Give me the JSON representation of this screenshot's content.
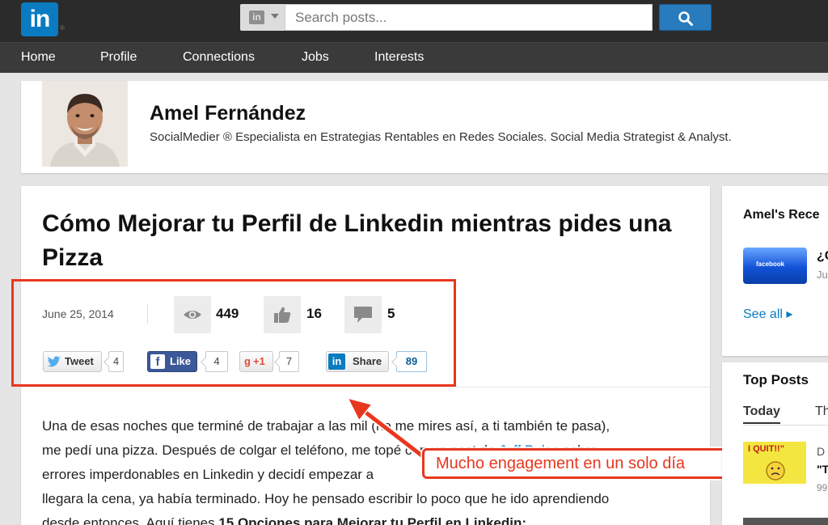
{
  "topbar": {
    "logo_text": "in",
    "logo_reg": "®",
    "search_scope_icon": "linkedin-mini-icon",
    "search_placeholder": "Search posts...",
    "search_button_icon": "search-icon"
  },
  "nav": {
    "items": [
      "Home",
      "Profile",
      "Connections",
      "Jobs",
      "Interests"
    ]
  },
  "profile": {
    "name": "Amel Fernández",
    "headline": "SocialMedier ® Especialista en Estrategias Rentables en Redes Sociales. Social Media Strategist & Analyst."
  },
  "article": {
    "title": "Cómo Mejorar tu Perfil de Linkedin mientras pides una Pizza",
    "date": "June 25, 2014",
    "stats": {
      "views": "449",
      "likes": "16",
      "comments": "5"
    },
    "share": {
      "tweet_label": "Tweet",
      "tweet_count": "4",
      "like_label": "Like",
      "like_count": "4",
      "gplus_label": "+1",
      "gplus_count": "7",
      "linkedin_label": "Share",
      "linkedin_count": "89"
    },
    "body": {
      "line1": "Una de esas noches que terminé de trabajar a las mil (no me mires así, a ti también te pasa),",
      "line2_a": "me pedí una pizza. Después de colgar el teléfono, me topé con un post de ",
      "line2_link": "Jeff Bulas",
      "line2_b": " sobre",
      "line3": "errores imperdonables en Linkedin y decidí empezar a",
      "line4": "llegara la cena, ya había terminado. Hoy he pensado escribir lo poco que he ido aprendiendo",
      "line5_a": "desde entonces. Aquí tienes ",
      "line5_bold": "15 Opciones para Mejorar tu Perfil en Linkedin:"
    }
  },
  "annotation": {
    "callout": "Mucho engagement en un solo día",
    "color": "#e8371f"
  },
  "sidebar": {
    "recent_title": "Amel's Rece",
    "recent_thumb_text": "facebook",
    "recent_item_title": "¿C",
    "recent_item_sub": "Ju",
    "see_all": "See all ▸",
    "top_posts_title": "Top Posts",
    "tab_today": "Today",
    "tab_other": "Th",
    "top_thumb_text": "I QUIT!!\"",
    "top_item_author": "D",
    "top_item_title": "\"T",
    "top_item_count": "99"
  },
  "colors": {
    "brand": "#0a7bc1",
    "topbar": "#2b2b2b",
    "nav": "#3a3a3a",
    "facebook": "#3b5998",
    "gplus": "#dd4b39",
    "twitter": "#55acee"
  }
}
